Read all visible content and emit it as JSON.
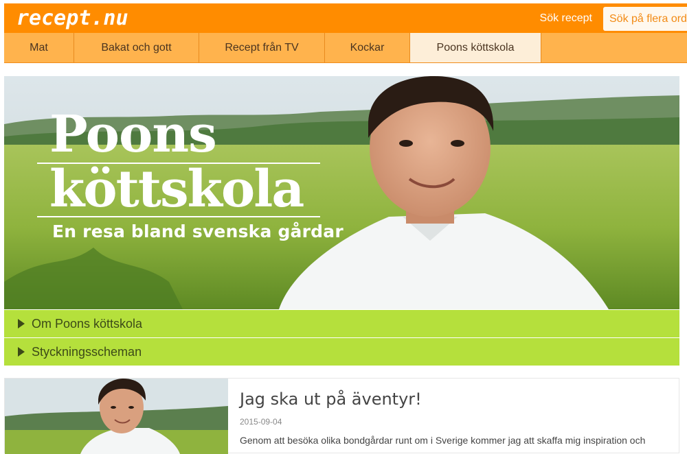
{
  "header": {
    "logo": "recept.nu",
    "search_link": "Sök recept",
    "search_placeholder": "Sök på flera ord"
  },
  "nav": {
    "items": [
      {
        "label": "Mat"
      },
      {
        "label": "Bakat och gott"
      },
      {
        "label": "Recept från TV"
      },
      {
        "label": "Kockar"
      },
      {
        "label": "Poons köttskola",
        "active": true
      }
    ]
  },
  "hero": {
    "title_line1": "Poons",
    "title_line2": "köttskola",
    "subtitle": "En resa bland svenska gårdar"
  },
  "accordion": {
    "items": [
      {
        "label": "Om Poons köttskola"
      },
      {
        "label": "Styckningsscheman"
      }
    ]
  },
  "article": {
    "title": "Jag ska ut på äventyr!",
    "date": "2015-09-04",
    "excerpt": "Genom att besöka olika bondgårdar runt om i Sverige kommer jag att skaffa mig inspiration och"
  },
  "colors": {
    "brand_orange": "#ff8c00",
    "nav_orange": "#ffb34d",
    "accordion_green": "#b5e03c"
  }
}
